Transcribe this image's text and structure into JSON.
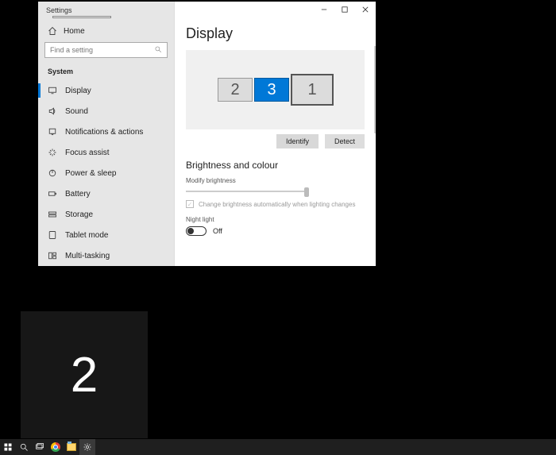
{
  "window": {
    "app_title": "Settings",
    "page_title": "Display"
  },
  "sidebar": {
    "home": "Home",
    "search_placeholder": "Find a setting",
    "group": "System",
    "items": [
      {
        "label": "Display",
        "icon": "display-icon",
        "active": true
      },
      {
        "label": "Sound",
        "icon": "sound-icon"
      },
      {
        "label": "Notifications & actions",
        "icon": "notifications-icon"
      },
      {
        "label": "Focus assist",
        "icon": "focus-assist-icon"
      },
      {
        "label": "Power & sleep",
        "icon": "power-icon"
      },
      {
        "label": "Battery",
        "icon": "battery-icon"
      },
      {
        "label": "Storage",
        "icon": "storage-icon"
      },
      {
        "label": "Tablet mode",
        "icon": "tablet-icon"
      },
      {
        "label": "Multi-tasking",
        "icon": "multitasking-icon"
      }
    ]
  },
  "display": {
    "monitors": [
      {
        "id": "2"
      },
      {
        "id": "3",
        "selected": true
      },
      {
        "id": "1"
      }
    ],
    "identify_btn": "Identify",
    "detect_btn": "Detect",
    "section_brightness": "Brightness and colour",
    "modify_brightness": "Modify brightness",
    "auto_brightness": "Change brightness automatically when lighting changes",
    "night_light_label": "Night light",
    "night_light_state": "Off"
  },
  "identify_overlay": "2",
  "taskbar": {
    "items": [
      "start",
      "search",
      "task-view",
      "chrome",
      "file-explorer",
      "settings"
    ]
  }
}
